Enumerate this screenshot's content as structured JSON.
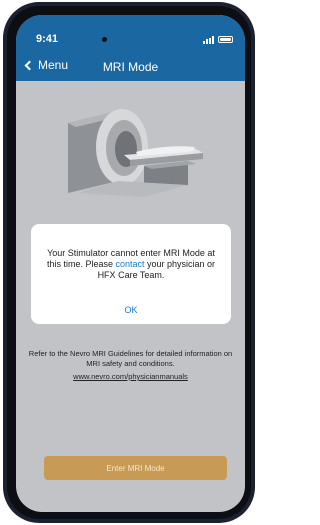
{
  "status_bar": {
    "time": "9:41",
    "signal_icon": "cellular-signal-icon",
    "battery_icon": "battery-icon"
  },
  "nav": {
    "back_label": "Menu",
    "title": "MRI Mode"
  },
  "illustration": {
    "icon": "mri-scanner-illustration"
  },
  "dialog": {
    "message_before_link": "Your Stimulator cannot enter MRI Mode at this time. Please ",
    "link_text": "contact",
    "message_after_link": " your physician or HFX Care Team.",
    "ok_label": "OK"
  },
  "guidelines": {
    "text": "Refer to the Nevro MRI Guidelines for detailed information on MRI safety and conditions.",
    "link": "www.nevro.com/physicianmanuals"
  },
  "action": {
    "enter_label": "Enter MRI Mode"
  },
  "colors": {
    "header": "#1a67a1",
    "overlay_background": "#c2c3c6",
    "link": "#1a7bc7",
    "button_disabled": "#c79b55"
  }
}
